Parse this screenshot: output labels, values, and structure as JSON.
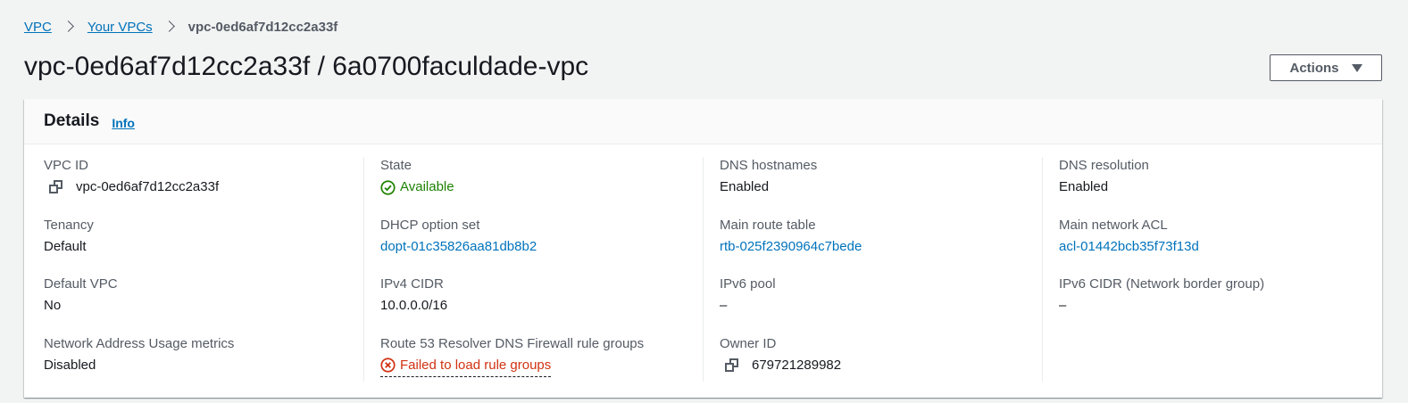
{
  "breadcrumb": {
    "items": [
      {
        "label": "VPC"
      },
      {
        "label": "Your VPCs"
      },
      {
        "label": "vpc-0ed6af7d12cc2a33f"
      }
    ]
  },
  "page": {
    "title": "vpc-0ed6af7d12cc2a33f / 6a0700faculdade-vpc",
    "actions_label": "Actions"
  },
  "details": {
    "heading": "Details",
    "info_label": "Info",
    "columns": [
      [
        {
          "label": "VPC ID",
          "value": "vpc-0ed6af7d12cc2a33f",
          "icon": "copy-icon"
        },
        {
          "label": "Tenancy",
          "value": "Default"
        },
        {
          "label": "Default VPC",
          "value": "No"
        },
        {
          "label": "Network Address Usage metrics",
          "value": "Disabled"
        }
      ],
      [
        {
          "label": "State",
          "value": "Available",
          "icon": "check-circle-icon",
          "color": "#1d8102"
        },
        {
          "label": "DHCP option set",
          "value": "dopt-01c35826aa81db8b2"
        },
        {
          "label": "IPv4 CIDR",
          "value": "10.0.0.0/16"
        },
        {
          "label": "Route 53 Resolver DNS Firewall rule groups",
          "value": "Failed to load rule groups",
          "icon": "error-circle-icon",
          "color": "#d13212"
        }
      ],
      [
        {
          "label": "DNS hostnames",
          "value": "Enabled"
        },
        {
          "label": "Main route table",
          "value": "rtb-025f2390964c7bede"
        },
        {
          "label": "IPv6 pool",
          "value": "–"
        },
        {
          "label": "Owner ID",
          "value": "679721289982",
          "icon": "copy-icon"
        }
      ],
      [
        {
          "label": "DNS resolution",
          "value": "Enabled"
        },
        {
          "label": "Main network ACL",
          "value": "acl-01442bcb35f73f13d"
        },
        {
          "label": "IPv6 CIDR (Network border group)",
          "value": "–"
        }
      ]
    ]
  },
  "colors": {
    "link": "#0073bb",
    "success": "#1d8102",
    "error": "#d13212"
  }
}
